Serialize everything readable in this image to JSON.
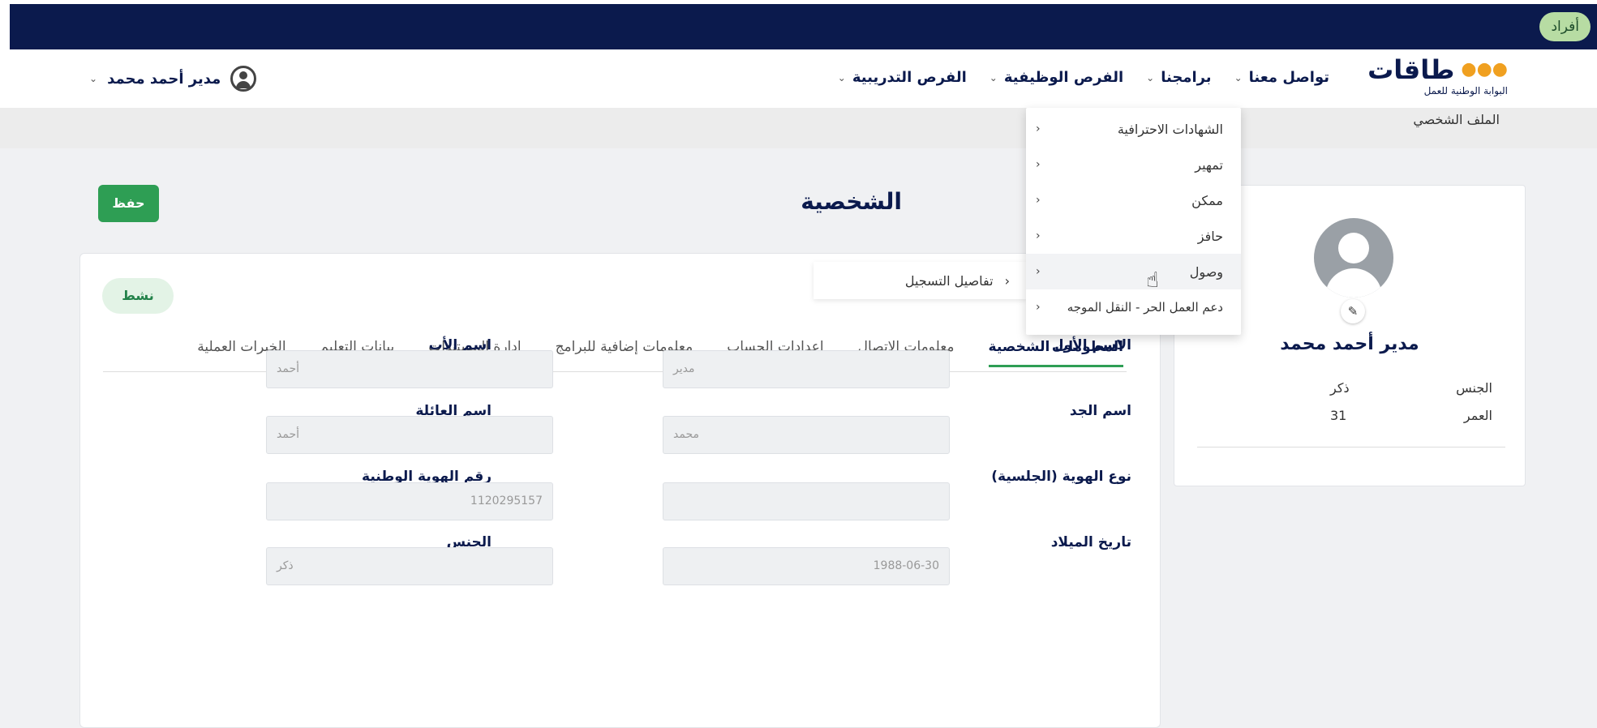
{
  "topbar": {
    "afrad_label": "أفراد"
  },
  "logo": {
    "name": "طاقات",
    "subtitle": "البوابة الوطنية للعمل"
  },
  "nav": {
    "items": [
      {
        "label": "تواصل معنا"
      },
      {
        "label": "برامجنا"
      },
      {
        "label": "الفرص الوظيفية"
      },
      {
        "label": "الفرص التدريبية"
      }
    ]
  },
  "user": {
    "name": "مدير أحمد محمد"
  },
  "breadcrumb": "الملف الشخصي",
  "page": {
    "title": "الشخصية",
    "save_label": "حفظ"
  },
  "profile": {
    "name": "مدير أحمد محمد",
    "rows": [
      {
        "label": "الجنس",
        "value": "ذكر"
      },
      {
        "label": "العمر",
        "value": "31"
      }
    ]
  },
  "status": "نشط",
  "tabs": [
    {
      "label": "المعلومات الشخصية",
      "active": true
    },
    {
      "label": "معلومات الاتصال"
    },
    {
      "label": "إعدادات الحساب"
    },
    {
      "label": "معلومات إضافية للبرامج"
    },
    {
      "label": "إدارة المستندات"
    },
    {
      "label": "بيانات التعليم"
    },
    {
      "label": "الخبرات العملية"
    }
  ],
  "form": {
    "first_name": {
      "label": "الاسم الأول",
      "value": "مدير"
    },
    "father_name": {
      "label": "اسم الأب",
      "value": "أحمد"
    },
    "grandfather_name": {
      "label": "اسم الجد",
      "value": "محمد"
    },
    "family_name": {
      "label": "اسم العائلة",
      "value": "أحمد"
    },
    "id_type": {
      "label": "نوع الهوية (الجلسية)",
      "value": ""
    },
    "national_id": {
      "label": "رقم الهوية الوطنية",
      "value": "1120295157"
    },
    "birth_date": {
      "label": "تاريخ الميلاد",
      "value": "1988-06-30"
    },
    "gender": {
      "label": "الجنس",
      "value": "ذكر"
    }
  },
  "dropdown": {
    "items": [
      {
        "label": "الشهادات الاحترافية"
      },
      {
        "label": "تمهير"
      },
      {
        "label": "ممكن"
      },
      {
        "label": "حافز"
      },
      {
        "label": "وصول"
      },
      {
        "label": "دعم العمل الحر - النقل الموجه"
      }
    ],
    "submenu_label": "تفاصيل التسجيل"
  }
}
